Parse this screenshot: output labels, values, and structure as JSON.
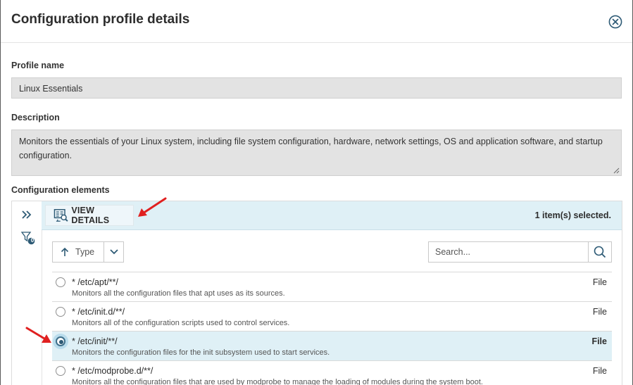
{
  "dialog": {
    "title": "Configuration profile details"
  },
  "profile": {
    "name_label": "Profile name",
    "name_value": "Linux Essentials",
    "description_label": "Description",
    "description_value": "Monitors the essentials of your Linux system, including file system configuration, hardware, network settings, OS and application software, and startup configuration."
  },
  "elements": {
    "label": "Configuration elements",
    "filter_badge": "0",
    "toolbar": {
      "view_details_label": "VIEW DETAILS",
      "selected_count": "1 item(s) selected."
    },
    "sort": {
      "label": "Type"
    },
    "search": {
      "placeholder": "Search..."
    },
    "items": [
      {
        "path": "* /etc/apt/**/",
        "description": "Monitors all the configuration files that apt uses as its sources.",
        "type": "File",
        "selected": false
      },
      {
        "path": "* /etc/init.d/**/",
        "description": "Monitors all of the configuration scripts used to control services.",
        "type": "File",
        "selected": false
      },
      {
        "path": "* /etc/init/**/",
        "description": "Monitors the configuration files for the init subsystem used to start services.",
        "type": "File",
        "selected": true
      },
      {
        "path": "* /etc/modprobe.d/**/",
        "description": "Monitors all the configuration files that are used by modprobe to manage the loading of modules during the system boot.",
        "type": "File",
        "selected": false
      }
    ]
  },
  "colors": {
    "selected_row": "#dff0f6",
    "annotation_arrow": "#e02020",
    "icon_accent": "#2d5a75"
  }
}
